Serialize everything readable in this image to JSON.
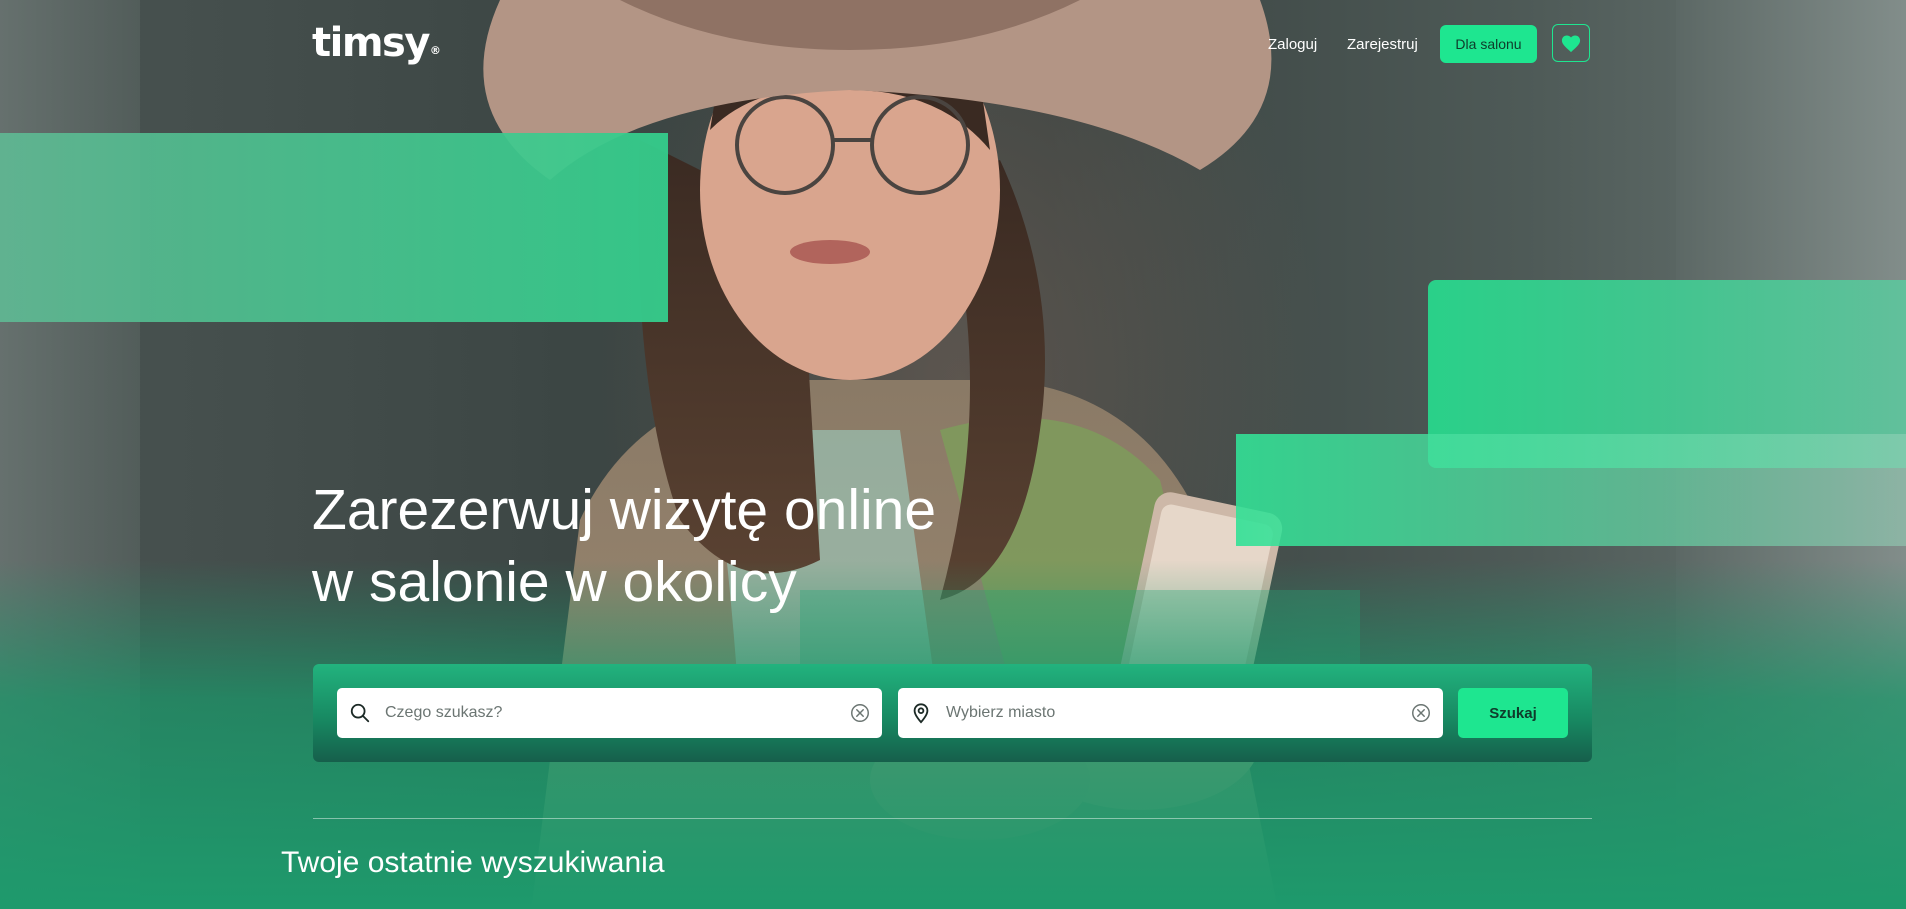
{
  "brand": {
    "logo_text": "timsy",
    "logo_mark": "®"
  },
  "header": {
    "login_label": "Zaloguj",
    "register_label": "Zarejestruj",
    "salon_button_label": "Dla salonu",
    "favorites_icon": "heart-icon"
  },
  "hero": {
    "headline_line1": "Zarezerwuj wizytę online",
    "headline_line2": "w salonie w okolicy"
  },
  "search": {
    "what_placeholder": "Czego szukasz?",
    "what_value": "",
    "city_placeholder": "Wybierz miasto",
    "city_value": "",
    "search_button_label": "Szukaj",
    "icons": {
      "what": "search-icon",
      "city": "location-pin-icon",
      "clear": "clear-circle-icon"
    }
  },
  "recent": {
    "title": "Twoje ostatnie wyszukiwania"
  },
  "colors": {
    "accent": "#1ee690",
    "accent_dark": "#178660",
    "button_text": "#0f3b2b"
  }
}
